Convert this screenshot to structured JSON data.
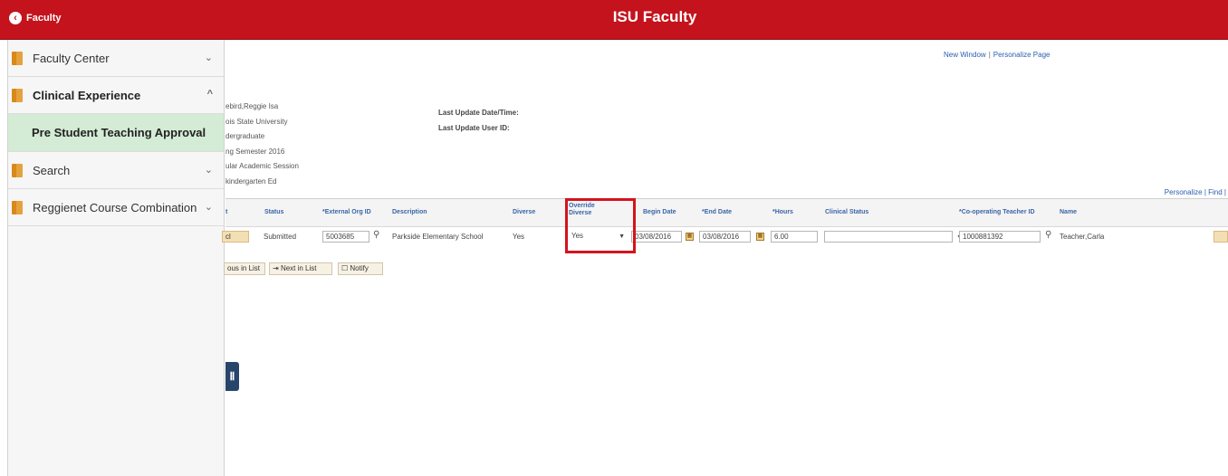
{
  "header": {
    "back_label": "Faculty",
    "title": "ISU Faculty"
  },
  "sidebar": {
    "items": [
      {
        "label": "Faculty Center",
        "chevron": "⌄"
      },
      {
        "label": "Clinical Experience",
        "chevron": "^"
      },
      {
        "label": "Search",
        "chevron": "⌄"
      },
      {
        "label": "Reggienet Course Combination",
        "chevron": "⌄"
      }
    ],
    "sub_item": "Pre Student Teaching Approval"
  },
  "toplinks": {
    "new_window": "New Window",
    "personalize": "Personalize Page"
  },
  "info_lines": [
    "ebird,Reggie Isa",
    "ois State University",
    "dergraduate",
    "ng Semester 2016",
    "ular Academic Session",
    "kindergarten Ed"
  ],
  "meta": {
    "last_update_datetime": "Last Update Date/Time:",
    "last_update_user": "Last Update User ID:"
  },
  "grid_links": {
    "personalize": "Personalize",
    "find": "Find"
  },
  "grid": {
    "headers": [
      "t",
      "Status",
      "*External Org ID",
      "Description",
      "Diverse",
      "Override Diverse",
      "Begin Date",
      "*End Date",
      "*Hours",
      "Clinical Status",
      "*Co-operating Teacher ID",
      "Name"
    ],
    "row": {
      "action": "cl",
      "status": "Submitted",
      "external_org_id": "5003685",
      "description": "Parkside Elementary School",
      "diverse": "Yes",
      "override_diverse": "Yes",
      "begin_date": "03/08/2016",
      "end_date": "03/08/2016",
      "hours": "6.00",
      "clinical_status": "",
      "teacher_id": "1000881392",
      "name": "Teacher,Carla"
    }
  },
  "actions": {
    "prev": "ous in List",
    "next": "Next in List",
    "notify": "Notify"
  },
  "colors": {
    "brand_red": "#c4131c",
    "selected_nav": "#d4ebd6",
    "highlight_box": "#d4131d"
  }
}
